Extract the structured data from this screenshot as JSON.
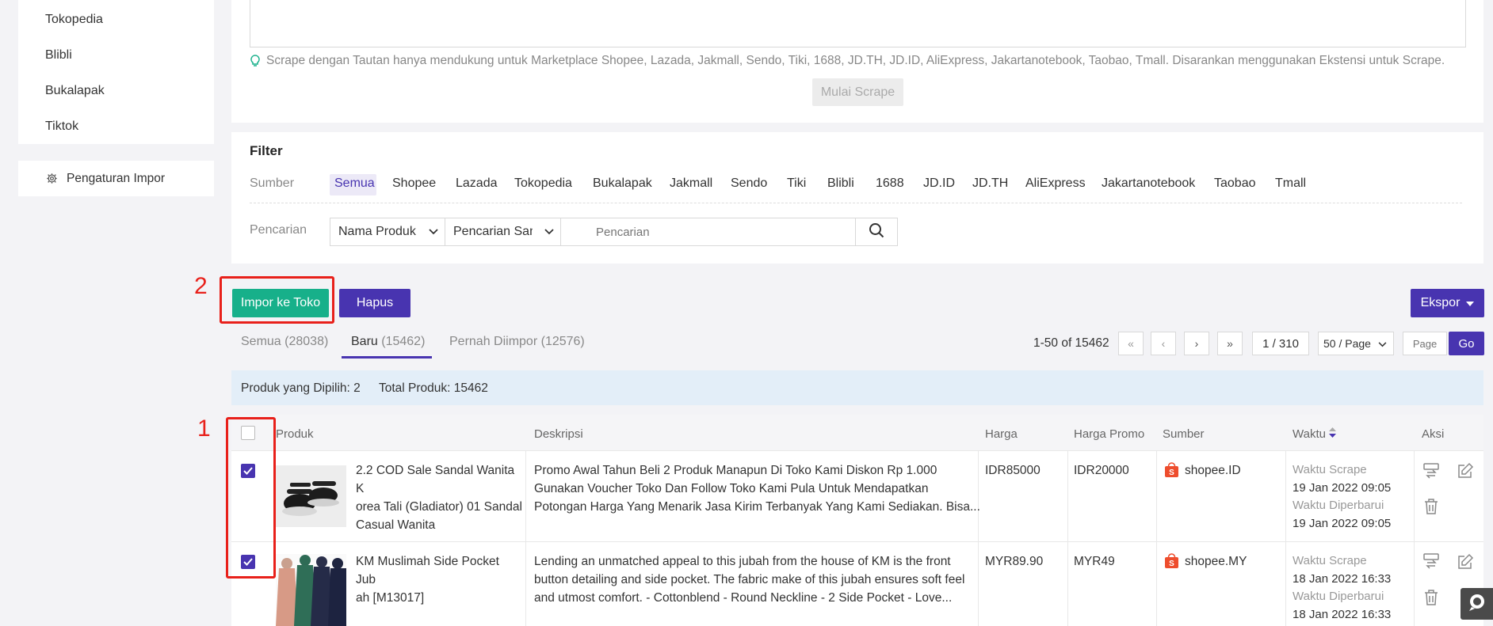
{
  "sidebar": {
    "items": [
      {
        "label": "Tokopedia"
      },
      {
        "label": "Blibli"
      },
      {
        "label": "Bukalapak"
      },
      {
        "label": "Tiktok"
      }
    ],
    "settings_label": "Pengaturan Impor"
  },
  "scrape": {
    "tip": "Scrape dengan Tautan hanya mendukung untuk Marketplace Shopee, Lazada, Jakmall, Sendo, Tiki, 1688, JD.TH, JD.ID, AliExpress, Jakartanotebook, Taobao, Tmall. Disarankan menggunakan Ekstensi untuk Scrape.",
    "start_button": "Mulai Scrape"
  },
  "filter": {
    "title": "Filter",
    "source_label": "Sumber",
    "sources": [
      "Semua",
      "Shopee",
      "Lazada",
      "Tokopedia",
      "Bukalapak",
      "Jakmall",
      "Sendo",
      "Tiki",
      "Blibli",
      "1688",
      "JD.ID",
      "JD.TH",
      "AliExpress",
      "Jakartanotebook",
      "Taobao",
      "Tmall"
    ],
    "active_source": "Semua",
    "search_label": "Pencarian",
    "field_select": "Nama Produk",
    "match_select": "Pencarian Sama",
    "search_placeholder": "Pencarian"
  },
  "annotations": {
    "marker_1": "1",
    "marker_2": "2"
  },
  "actions": {
    "import_button": "Impor ke Toko",
    "delete_button": "Hapus",
    "export_button": "Ekspor"
  },
  "tabs": [
    {
      "label": "Semua",
      "count": "(28038)"
    },
    {
      "label": "Baru",
      "count": "(15462)",
      "active": true
    },
    {
      "label": "Pernah Diimpor",
      "count": "(12576)"
    }
  ],
  "pagination": {
    "range": "1-50 of 15462",
    "page_indicator": "1 / 310",
    "per_page": "50 / Page",
    "page_placeholder": "Page",
    "go_label": "Go"
  },
  "summary": {
    "selected": "Produk yang Dipilih: 2",
    "total": "Total Produk: 15462"
  },
  "table": {
    "headers": {
      "product": "Produk",
      "description": "Deskripsi",
      "price": "Harga",
      "promo_price": "Harga Promo",
      "source": "Sumber",
      "time": "Waktu",
      "action": "Aksi"
    },
    "rows": [
      {
        "checked": true,
        "name": [
          "2.2 COD Sale Sandal Wanita K",
          "orea Tali (Gladiator) 01 Sandal",
          "Casual Wanita"
        ],
        "description": [
          "Promo Awal Tahun Beli 2 Produk Manapun Di Toko Kami Diskon Rp 1.000",
          "Gunakan Voucher Toko Dan Follow Toko Kami Pula Untuk Mendapatkan",
          "Potongan Harga Yang Menarik Jasa Kirim Terbanyak Yang Kami Sediakan. Bisa..."
        ],
        "price": "IDR85000",
        "promo_price": "IDR20000",
        "source": "shopee.ID",
        "scrape_label": "Waktu Scrape",
        "scrape_time": "19 Jan 2022 09:05",
        "update_label": "Waktu Diperbarui",
        "update_time": "19 Jan 2022 09:05"
      },
      {
        "checked": true,
        "name": [
          "KM Muslimah Side Pocket Jub",
          "ah [M13017]"
        ],
        "description": [
          "Lending an unmatched appeal to this jubah from the house of KM is the front",
          "button detailing and side pocket. The fabric make of this jubah ensures soft feel",
          "and utmost comfort. - Cottonblend - Round Neckline - 2 Side Pocket - Love..."
        ],
        "price": "MYR89.90",
        "promo_price": "MYR49",
        "source": "shopee.MY",
        "scrape_label": "Waktu Scrape",
        "scrape_time": "18 Jan 2022 16:33",
        "update_label": "Waktu Diperbarui",
        "update_time": "18 Jan 2022 16:33"
      }
    ]
  },
  "colors": {
    "primary": "#4834b0",
    "green": "#17b08a",
    "shopee": "#ee4d2d",
    "annotation": "#e8201a"
  }
}
